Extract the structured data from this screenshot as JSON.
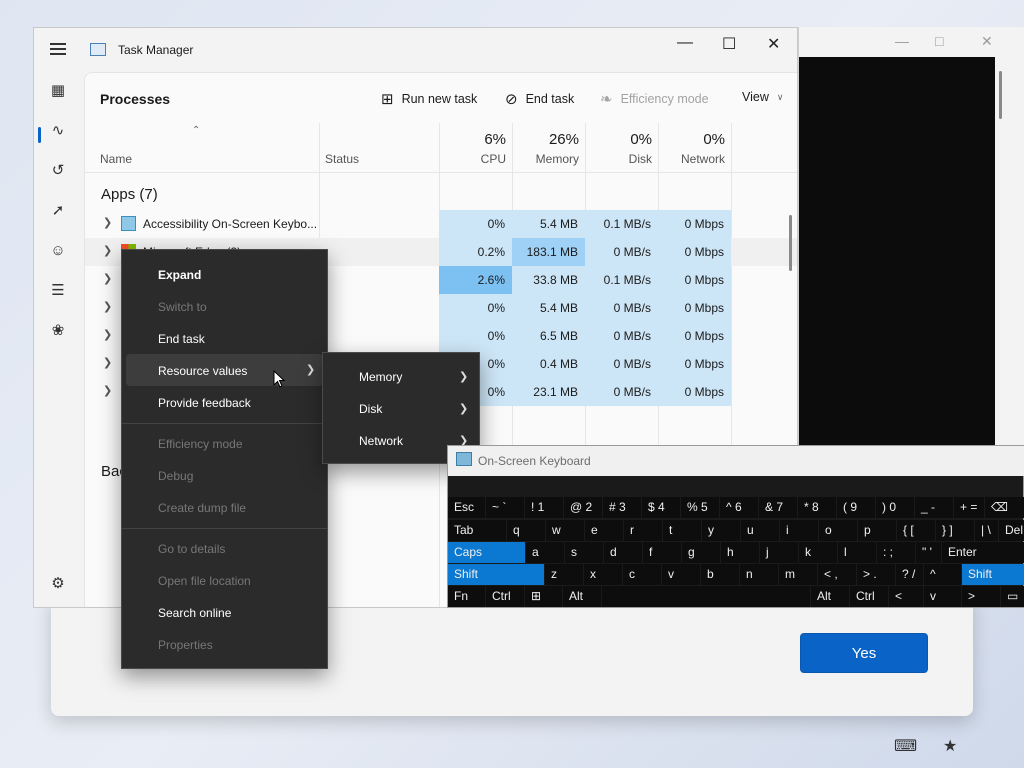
{
  "dialog": {
    "yes_label": "Yes"
  },
  "task_manager": {
    "title": "Task Manager",
    "page_title": "Processes",
    "toolbar": {
      "run_new_task": "Run new task",
      "end_task": "End task",
      "efficiency_mode": "Efficiency mode",
      "view": "View"
    },
    "columns": {
      "name": "Name",
      "status": "Status",
      "cpu_pct": "6%",
      "cpu": "CPU",
      "memory_pct": "26%",
      "memory": "Memory",
      "disk_pct": "0%",
      "disk": "Disk",
      "network_pct": "0%",
      "network": "Network"
    },
    "group_apps": "Apps (7)",
    "group_background": "Bac",
    "rows": [
      {
        "name": "Accessibility On-Screen Keybo...",
        "cpu": "0%",
        "memory": "5.4 MB",
        "disk": "0.1 MB/s",
        "network": "0 Mbps"
      },
      {
        "name": "Microsoft Edge (2)",
        "cpu": "0.2%",
        "memory": "183.1 MB",
        "disk": "0 MB/s",
        "network": "0 Mbps"
      },
      {
        "name": "",
        "cpu": "2.6%",
        "memory": "33.8 MB",
        "disk": "0.1 MB/s",
        "network": "0 Mbps"
      },
      {
        "name": "",
        "cpu": "0%",
        "memory": "5.4 MB",
        "disk": "0 MB/s",
        "network": "0 Mbps"
      },
      {
        "name": "",
        "cpu": "0%",
        "memory": "6.5 MB",
        "disk": "0 MB/s",
        "network": "0 Mbps"
      },
      {
        "name": "",
        "cpu": "0%",
        "memory": "0.4 MB",
        "disk": "0 MB/s",
        "network": "0 Mbps"
      },
      {
        "name": "",
        "cpu": "0%",
        "memory": "23.1 MB",
        "disk": "0 MB/s",
        "network": "0 Mbps"
      }
    ]
  },
  "context_menu": {
    "expand": "Expand",
    "switch_to": "Switch to",
    "end_task": "End task",
    "resource_values": "Resource values",
    "provide_feedback": "Provide feedback",
    "efficiency_mode": "Efficiency mode",
    "debug": "Debug",
    "create_dump": "Create dump file",
    "go_to_details": "Go to details",
    "open_file_location": "Open file location",
    "search_online": "Search online",
    "properties": "Properties"
  },
  "submenu": {
    "memory": "Memory",
    "disk": "Disk",
    "network": "Network"
  },
  "osk": {
    "title": "On-Screen Keyboard",
    "rows": [
      [
        "Esc",
        "~ `",
        "! 1",
        "@ 2",
        "# 3",
        "$ 4",
        "% 5",
        "^ 6",
        "& 7",
        "* 8",
        "( 9",
        ") 0",
        "_ -",
        "+ =",
        "⌫"
      ],
      [
        "Tab",
        "q",
        "w",
        "e",
        "r",
        "t",
        "y",
        "u",
        "i",
        "o",
        "p",
        "{ [",
        "} ]",
        "| \\",
        "Del"
      ],
      [
        "Caps",
        "a",
        "s",
        "d",
        "f",
        "g",
        "h",
        "j",
        "k",
        "l",
        ": ;",
        "\" '",
        "Enter"
      ],
      [
        "Shift",
        "z",
        "x",
        "c",
        "v",
        "b",
        "n",
        "m",
        "< ,",
        "> .",
        "? /",
        "^",
        "Shift"
      ],
      [
        "Fn",
        "Ctrl",
        "⊞",
        "Alt",
        "",
        "Alt",
        "Ctrl",
        "<",
        "v",
        ">",
        "▭"
      ]
    ]
  }
}
